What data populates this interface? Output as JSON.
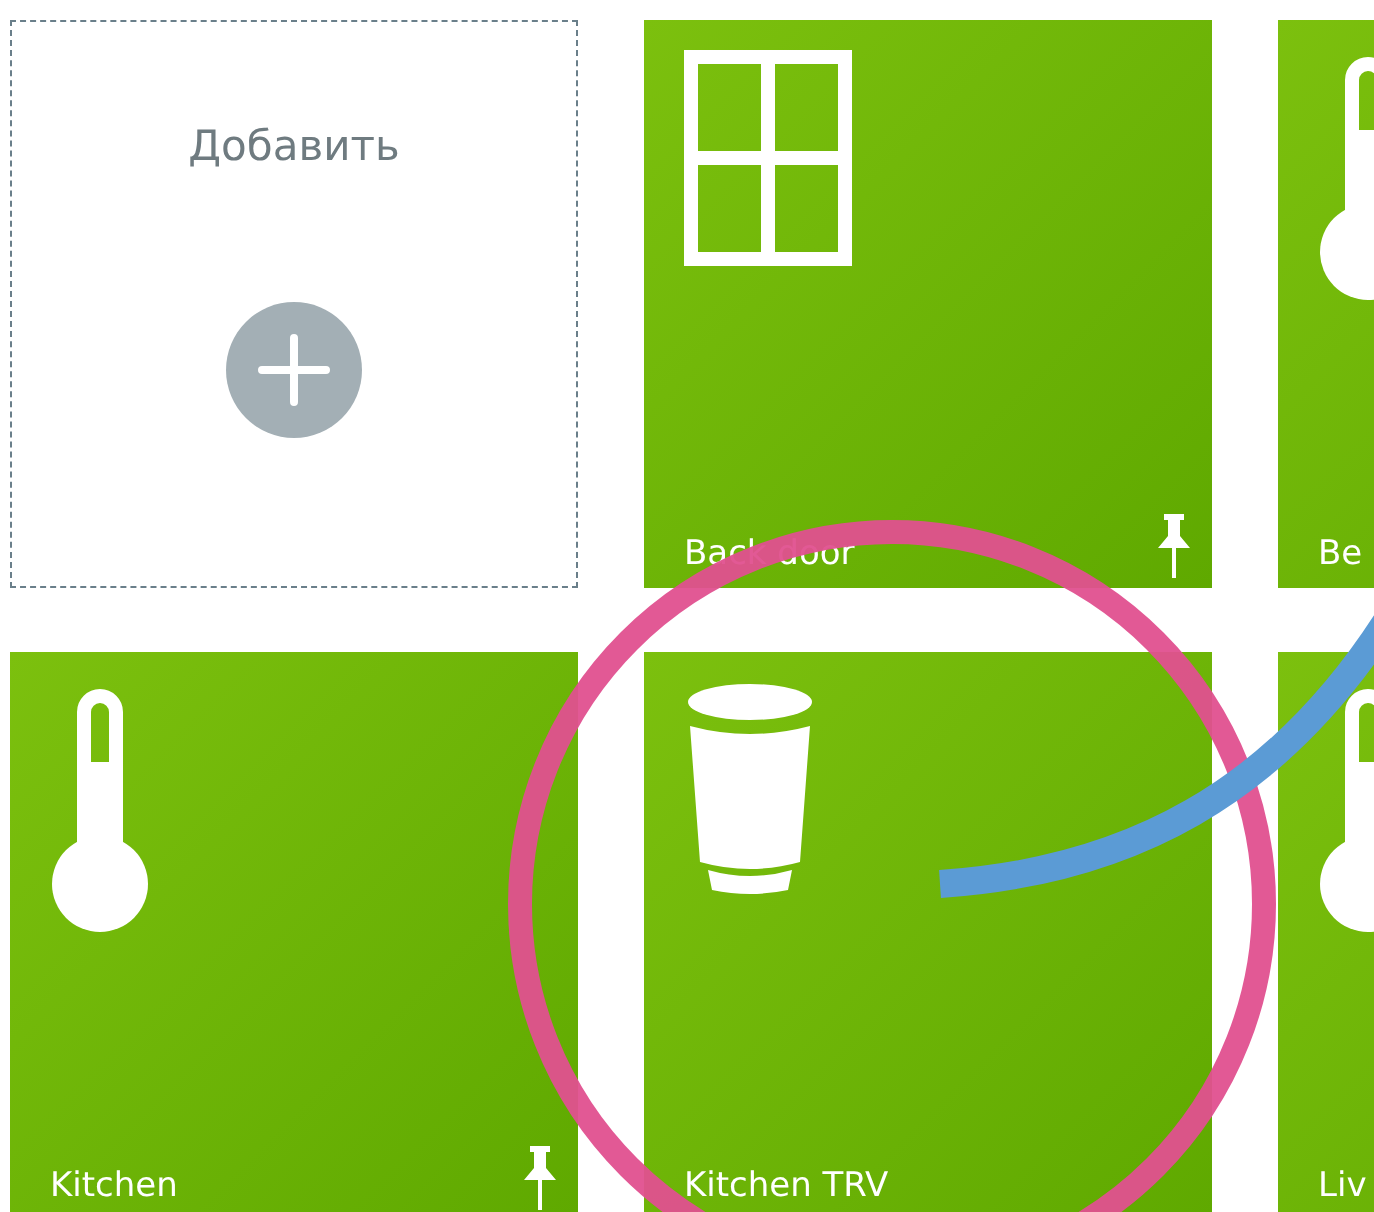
{
  "add_tile": {
    "label": "Добавить"
  },
  "tiles": [
    {
      "label": "Back door",
      "kind": "window",
      "pinned": true
    },
    {
      "label": "Be",
      "kind": "thermometer"
    },
    {
      "label": "Kitchen",
      "kind": "thermometer",
      "pinned": true
    },
    {
      "label": "Kitchen TRV",
      "kind": "valve",
      "pinned": false
    },
    {
      "label": "Liv",
      "kind": "thermometer"
    }
  ]
}
